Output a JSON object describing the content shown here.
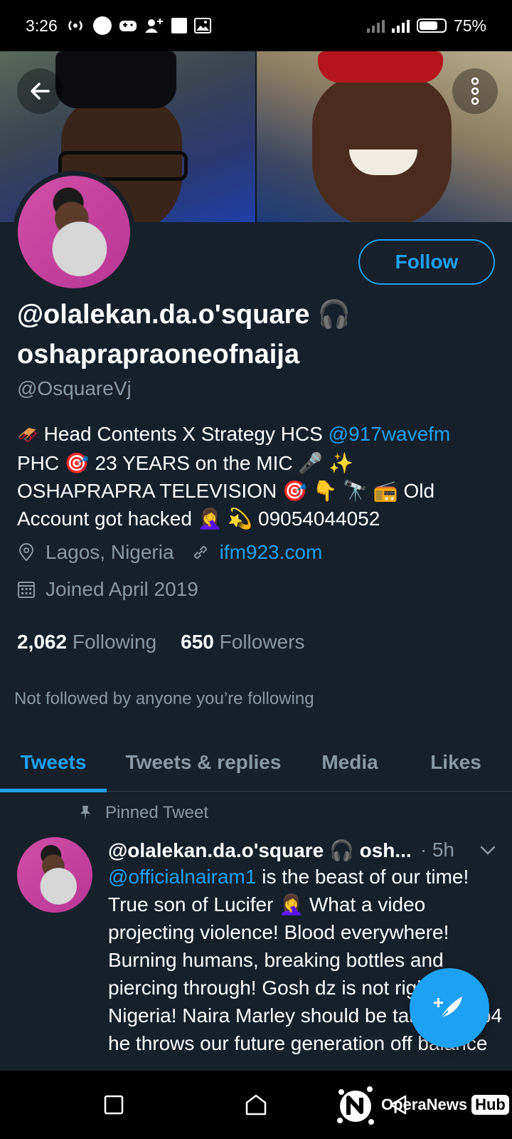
{
  "status_bar": {
    "time": "3:26",
    "battery_text": "75%",
    "battery_level": 0.75
  },
  "header": {
    "back_icon": "arrow-left-icon",
    "more_icon": "more-vertical-icon"
  },
  "profile": {
    "display_name": "@olalekan.da.o'square 🎧 oshaprapraoneofnaija",
    "handle": "@OsquareVj",
    "follow_label": "Follow",
    "bio": {
      "line1_text": " Head Contents X Strategy HCS ",
      "line1_mention": "@917wavefm",
      "line2_text": "PHC 🎯  23 YEARS on the MIC  🎤  ✨",
      "line3_text": "OSHAPRAPRA TELEVISION 🎯  👇  🔭  📻 Old",
      "line4_text": "Account got hacked 🤦‍♀️  💫  09054044052"
    },
    "location": "Lagos, Nigeria",
    "website": "ifm923.com",
    "joined": "Joined April 2019",
    "following_count": "2,062",
    "following_label": "Following",
    "followers_count": "650",
    "followers_label": "Followers",
    "not_followed_note": "Not followed by anyone you’re following"
  },
  "tabs": [
    {
      "label": "Tweets",
      "active": true
    },
    {
      "label": "Tweets & replies",
      "active": false
    },
    {
      "label": "Media",
      "active": false
    },
    {
      "label": "Likes",
      "active": false
    }
  ],
  "pinned_tweet": {
    "pinned_label": "Pinned Tweet",
    "author": "@olalekan.da.o'square 🎧 osh...",
    "time": "· 5h",
    "mention": "@officialnairam1",
    "text": " is the beast of our time! True son of Lucifer 🤦‍♀️ What a video projecting violence! Blood everywhere! Burning humans, breaking bottles and piercing through! Gosh dz is not right Nigeria! Naira Marley should be taken out b4 he throws our future generation off balance"
  },
  "watermark": {
    "brand": "OperaNews",
    "hub": "Hub"
  },
  "colors": {
    "background": "#15202b",
    "accent": "#1da1f2",
    "secondary_text": "#8899a6"
  }
}
